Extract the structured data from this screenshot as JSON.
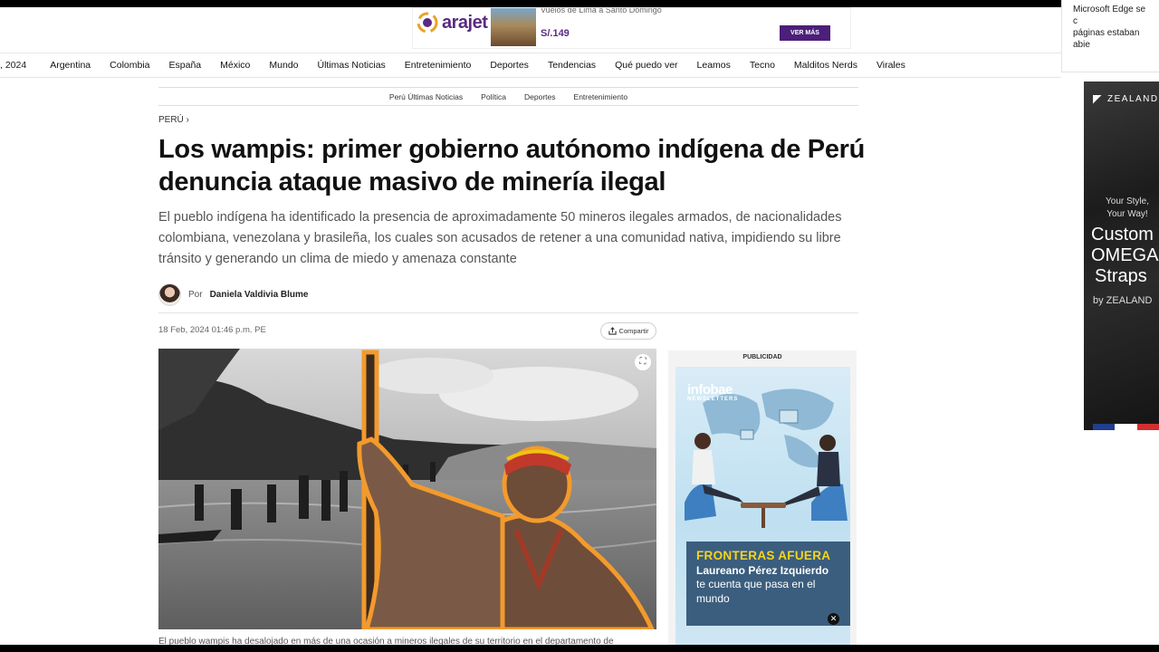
{
  "edge_notification": {
    "line1": "Microsoft Edge se c",
    "line2": "páginas estaban abie"
  },
  "top_ad": {
    "brand": "arajet",
    "route": "Vuelos de Lima a Santo Domingo",
    "price": "S/.149",
    "cta": "VER MÁS"
  },
  "nav": {
    "date": ", 2024",
    "items": [
      "Argentina",
      "Colombia",
      "España",
      "México",
      "Mundo",
      "Últimas Noticias",
      "Entretenimiento",
      "Deportes",
      "Tendencias",
      "Qué puedo ver",
      "Leamos",
      "Tecno",
      "Malditos Nerds",
      "Virales"
    ]
  },
  "subnav": {
    "items": [
      "Perú Últimas Noticias",
      "Política",
      "Deportes",
      "Entretenimiento"
    ]
  },
  "article": {
    "breadcrumb": "PERÚ ›",
    "headline": "Los wampis: primer gobierno autónomo indígena de Perú denuncia ataque masivo de minería ilegal",
    "deck": "El pueblo indígena ha identificado la presencia de aproximadamente 50 mineros ilegales armados, de nacionalidades colombiana, venezolana y brasileña, los cuales son acusados de retener a una comunidad nativa, impidiendo su libre tránsito y generando un clima de miedo y amenaza constante",
    "author_prefix": "Por",
    "author_name": "Daniela Valdivia Blume",
    "date": "18 Feb, 2024 01:46 p.m. PE",
    "share_label": "Compartir",
    "caption": "El pueblo wampis ha desalojado en más de una ocasión a mineros ilegales de su territorio en el departamento de"
  },
  "side_ad": {
    "label": "PUBLICIDAD",
    "brand": "infobae",
    "sub": "NEWSLETTERS",
    "title": "FRONTERAS AFUERA",
    "name": "Laureano Pérez Izquierdo",
    "text": "te cuenta que pasa en el mundo"
  },
  "right_ad": {
    "brand": "ZEALAND",
    "slogan1": "Your Style,",
    "slogan2": "Your Way!",
    "custom1": "Custom",
    "custom2": "OMEGA",
    "custom3": "Straps",
    "by": "by ZEALAND"
  },
  "colors": {
    "accent": "#f39a2c",
    "ad_purple": "#4b1f7a",
    "fronteras_yellow": "#f4d51c"
  }
}
